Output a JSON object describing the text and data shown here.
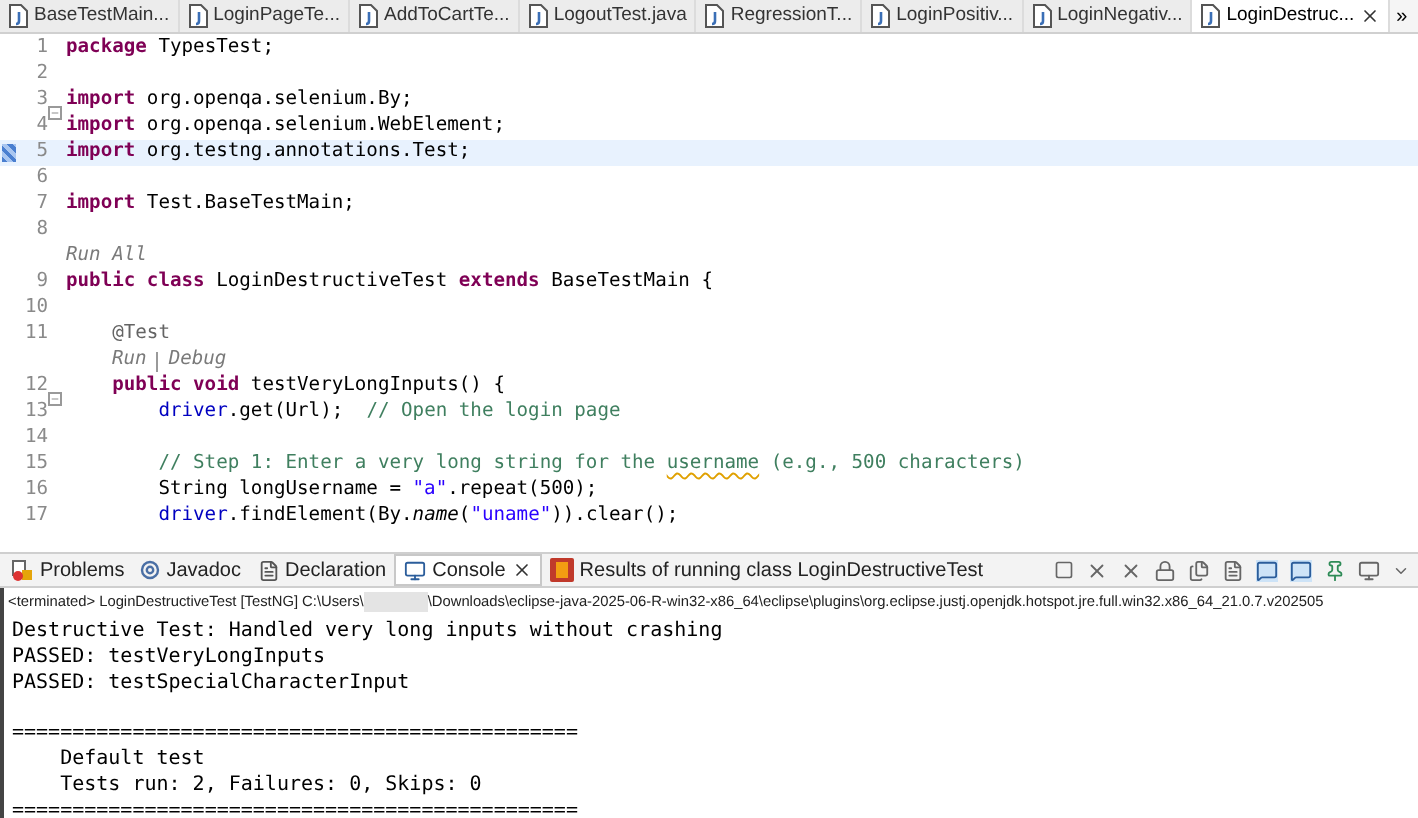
{
  "editor_tabs": [
    {
      "label": "BaseTestMain...",
      "selected": false
    },
    {
      "label": "LoginPageTe...",
      "selected": false
    },
    {
      "label": "AddToCartTe...",
      "selected": false
    },
    {
      "label": "LogoutTest.java",
      "selected": false
    },
    {
      "label": "RegressionT...",
      "selected": false
    },
    {
      "label": "LoginPositiv...",
      "selected": false
    },
    {
      "label": "LoginNegativ...",
      "selected": false
    },
    {
      "label": "LoginDestruc...",
      "selected": true
    }
  ],
  "tabs_overflow": "»",
  "code_lines": [
    {
      "kind": "code",
      "number": "1",
      "current": false,
      "fold_marker": false,
      "tokens": [
        {
          "kind": "keyword",
          "text": "package"
        },
        {
          "kind": "plain",
          "text": " TypesTest;"
        }
      ]
    },
    {
      "kind": "code",
      "number": "2",
      "current": false,
      "fold_marker": false
    },
    {
      "kind": "code",
      "number": "3",
      "current": false,
      "fold_marker": true,
      "tokens": [
        {
          "kind": "keyword",
          "text": "import"
        },
        {
          "kind": "plain",
          "text": " org.openqa.selenium.By;"
        }
      ]
    },
    {
      "kind": "code",
      "number": "4",
      "current": false,
      "fold_marker": false,
      "tokens": [
        {
          "kind": "keyword",
          "text": "import"
        },
        {
          "kind": "plain",
          "text": " org.openqa.selenium.WebElement;"
        }
      ]
    },
    {
      "kind": "code",
      "number": "5",
      "current": true,
      "fold_marker": false,
      "tokens": [
        {
          "kind": "keyword",
          "text": "import"
        },
        {
          "kind": "plain",
          "text": " org.testng.annotations.Test;"
        }
      ]
    },
    {
      "kind": "code",
      "number": "6",
      "current": false,
      "fold_marker": false
    },
    {
      "kind": "code",
      "number": "7",
      "current": false,
      "fold_marker": false,
      "tokens": [
        {
          "kind": "keyword",
          "text": "import"
        },
        {
          "kind": "plain",
          "text": " Test.BaseTestMain;"
        }
      ]
    },
    {
      "kind": "code",
      "number": "8",
      "current": false,
      "fold_marker": false
    },
    {
      "kind": "lens",
      "indented": false,
      "links": [
        "Run All"
      ]
    },
    {
      "kind": "code",
      "number": "9",
      "current": false,
      "fold_marker": false,
      "tokens": [
        {
          "kind": "keyword",
          "text": "public class"
        },
        {
          "kind": "plain",
          "text": " LoginDestructiveTest "
        },
        {
          "kind": "keyword",
          "text": "extends"
        },
        {
          "kind": "plain",
          "text": " BaseTestMain {"
        }
      ]
    },
    {
      "kind": "code",
      "number": "10",
      "current": false,
      "fold_marker": false
    },
    {
      "kind": "code",
      "number": "11",
      "current": false,
      "fold_marker": false,
      "tokens": [
        {
          "kind": "annotation",
          "text": "    @Test"
        }
      ]
    },
    {
      "kind": "lens",
      "indented": true,
      "links": [
        "Run",
        "Debug"
      ]
    },
    {
      "kind": "code",
      "number": "12",
      "current": false,
      "fold_marker": true,
      "tokens": [
        {
          "kind": "keyword",
          "text": "    public void"
        },
        {
          "kind": "plain",
          "text": " testVeryLongInputs() {"
        }
      ]
    },
    {
      "kind": "code",
      "number": "13",
      "current": false,
      "fold_marker": false,
      "tokens": [
        {
          "kind": "field",
          "text": "        driver"
        },
        {
          "kind": "plain",
          "text": ".get(Url);  "
        },
        {
          "kind": "comment",
          "text": "// Open the login page"
        }
      ]
    },
    {
      "kind": "code",
      "number": "14",
      "current": false,
      "fold_marker": false
    },
    {
      "kind": "code",
      "number": "15",
      "current": false,
      "fold_marker": false,
      "tokens": [
        {
          "kind": "comment",
          "text": "        // Step 1: Enter a very long string for the "
        },
        {
          "kind": "flagged_comment",
          "text": "username"
        },
        {
          "kind": "comment",
          "text": " (e.g., 500 characters)"
        }
      ]
    },
    {
      "kind": "code",
      "number": "16",
      "current": false,
      "fold_marker": false,
      "tokens": [
        {
          "kind": "plain",
          "text": "        String longUsername = "
        },
        {
          "kind": "string",
          "text": "\"a\""
        },
        {
          "kind": "plain",
          "text": ".repeat(500);"
        }
      ]
    },
    {
      "kind": "code",
      "number": "17",
      "current": false,
      "fold_marker": false,
      "tokens": [
        {
          "kind": "field",
          "text": "        driver"
        },
        {
          "kind": "plain",
          "text": ".findElement(By."
        },
        {
          "kind": "static_method",
          "text": "name"
        },
        {
          "kind": "plain",
          "text": "("
        },
        {
          "kind": "string",
          "text": "\"uname\""
        },
        {
          "kind": "plain",
          "text": ")).clear();"
        }
      ]
    }
  ],
  "console_tabs": [
    {
      "label": "Problems",
      "kind": "problems",
      "selected": false
    },
    {
      "label": "Javadoc",
      "kind": "javadoc",
      "selected": false
    },
    {
      "label": "Declaration",
      "kind": "declaration",
      "selected": false
    },
    {
      "label": "Console",
      "kind": "console",
      "selected": true
    },
    {
      "label": "Results of running class LoginDestructiveTest",
      "kind": "results",
      "selected": false
    }
  ],
  "console": {
    "process_prefix": "<terminated> LoginDestructiveTest [TestNG] C:\\Users\\",
    "process_suffix": "\\Downloads\\eclipse-java-2025-06-R-win32-x86_64\\eclipse\\plugins\\org.eclipse.justj.openjdk.hotspot.jre.full.win32.x86_64_21.0.7.v202505",
    "output_blocks": [
      [
        "Destructive Test: Handled very long inputs without crashing",
        "PASSED: testVeryLongInputs",
        "PASSED: testSpecialCharacterInput"
      ],
      [
        "===============================================",
        "    Default test",
        "    Tests run: 2, Failures: 0, Skips: 0",
        "==============================================="
      ]
    ]
  }
}
